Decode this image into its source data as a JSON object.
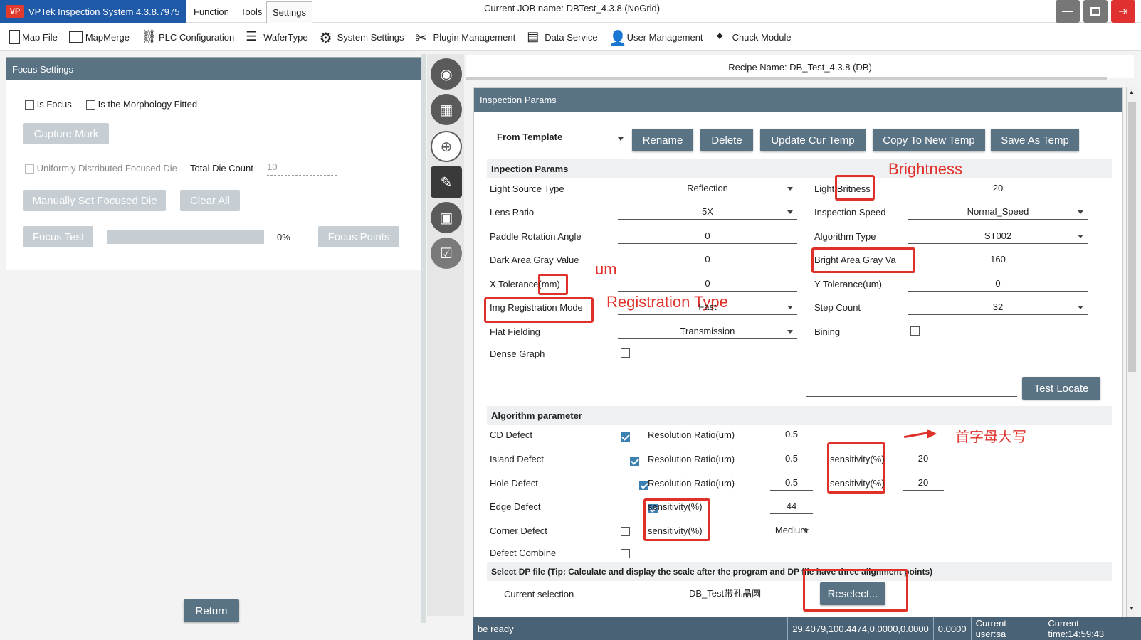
{
  "titlebar": {
    "app_title": "VPTek Inspection System 4.3.8.7975",
    "logo": "VP",
    "menus": [
      "Function",
      "Tools",
      "Settings"
    ],
    "job_label": "Current JOB name:",
    "job_value": "DBTest_4.3.8 (NoGrid)"
  },
  "toolbar": {
    "items": [
      "Map File",
      "MapMerge",
      "PLC Configuration",
      "WaferType",
      "System Settings",
      "Plugin Management",
      "Data Service",
      "User Management",
      "Chuck Module"
    ]
  },
  "focus": {
    "header": "Focus Settings",
    "is_focus": "Is Focus",
    "morph": "Is the Morphology Fitted",
    "capture": "Capture Mark",
    "uniform": "Uniformly Distributed Focused Die",
    "total_label": "Total Die Count",
    "total_value": "10",
    "manual": "Manually Set Focused Die",
    "clear": "Clear All",
    "focus_test": "Focus Test",
    "progress_text": "0%",
    "progress": 0,
    "focus_points": "Focus Points",
    "return": "Return"
  },
  "recipe": {
    "label": "Recipe Name: DB_Test_4.3.8 (DB)"
  },
  "inspection": {
    "header": "Inspection Params",
    "from_template": "From Template",
    "buttons": [
      "Rename",
      "Delete",
      "Update Cur Temp",
      "Copy To New Temp",
      "Save As Temp"
    ],
    "section1": "Inpection Params",
    "left_rows": [
      {
        "label": "Light Source Type",
        "value": "Reflection"
      },
      {
        "label": "Lens Ratio",
        "value": "5X"
      },
      {
        "label": "Paddle Rotation Angle",
        "value": "0"
      },
      {
        "label": "Dark Area Gray Value",
        "value": "0"
      },
      {
        "label": "X Tolerance(mm)",
        "value": "0"
      },
      {
        "label": "Img Registration Mode",
        "value": "Fast"
      },
      {
        "label": "Flat Fielding",
        "value": "Transmission"
      },
      {
        "label": "Dense Graph",
        "value": ""
      }
    ],
    "right_rows": [
      {
        "label": "Light Britness",
        "value": "20"
      },
      {
        "label": "Inspection Speed",
        "value": "Normal_Speed"
      },
      {
        "label": "Algorithm Type",
        "value": "ST002"
      },
      {
        "label": "Bright Area Gray Va",
        "value": "160"
      },
      {
        "label": "Y Tolerance(um)",
        "value": "0"
      },
      {
        "label": "Step Count",
        "value": "32"
      },
      {
        "label": "Bining",
        "value": ""
      }
    ],
    "test_locate": "Test Locate",
    "section2": "Algorithm parameter",
    "algo_rows": [
      {
        "label": "CD Defect",
        "param": "Resolution Ratio(um)",
        "value": "0.5",
        "sens_label": "",
        "sens_value": ""
      },
      {
        "label": "Island Defect",
        "param": "Resolution Ratio(um)",
        "value": "0.5",
        "sens_label": "sensitivity(%)",
        "sens_value": "20"
      },
      {
        "label": "Hole Defect",
        "param": "Resolution Ratio(um)",
        "value": "0.5",
        "sens_label": "sensitivity(%)",
        "sens_value": "20"
      },
      {
        "label": "Edge Defect",
        "param": "sensitivity(%)",
        "value": "44",
        "sens_label": "",
        "sens_value": ""
      },
      {
        "label": "Corner Defect",
        "param": "sensitivity(%)",
        "value": "Medium",
        "sens_label": "",
        "sens_value": ""
      },
      {
        "label": "Defect Combine",
        "param": "",
        "value": "",
        "sens_label": "",
        "sens_value": ""
      }
    ],
    "section3": "Select DP file (Tip: Calculate and display the scale after the program and DP file have three alignment points)",
    "current_selection": "Current selection",
    "dp_value": "DB_Test带孔晶圆",
    "reselect": "Reselect..."
  },
  "annotations": {
    "brightness": "Brightness",
    "um": "um",
    "registration": "Registration Type",
    "capital": "首字母大写"
  },
  "status": {
    "ready": "be ready",
    "coords": "29.4079,100.4474,0.0000,0.0000",
    "val": "0.0000",
    "user": "Current user:sa",
    "time": "Current time:14:59:43"
  }
}
